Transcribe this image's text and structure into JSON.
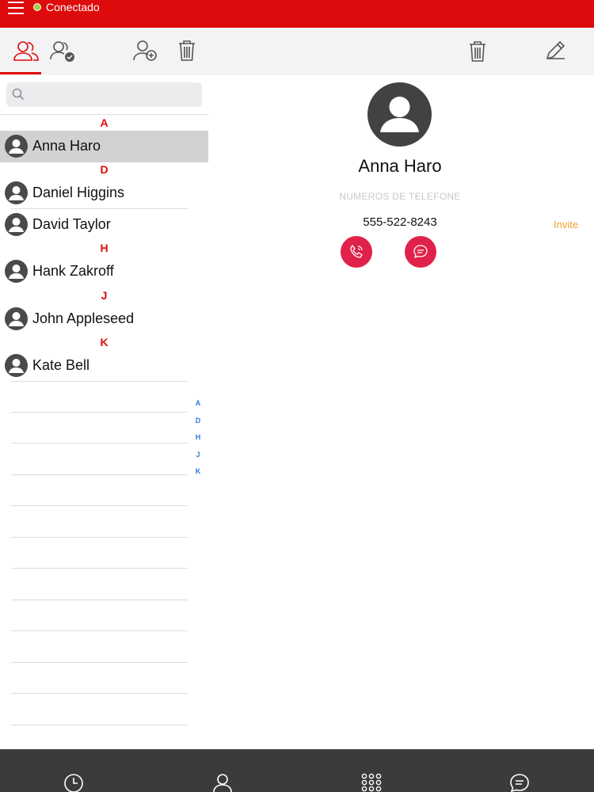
{
  "status": {
    "connection_text": "Conectado",
    "connection_color": "#9ecf3e",
    "bar_color": "#dd0b0b"
  },
  "toolbar_left": {
    "icons": [
      "contacts-icon",
      "shared-contacts-icon",
      "add-contact-icon",
      "trash-icon"
    ]
  },
  "toolbar_right": {
    "icons": [
      "trash-icon",
      "edit-pencil-icon"
    ]
  },
  "search": {
    "placeholder": "",
    "value": ""
  },
  "contacts": {
    "sections": [
      {
        "letter": "A",
        "items": [
          "Anna Haro"
        ]
      },
      {
        "letter": "D",
        "items": [
          "Daniel Higgins",
          "David Taylor"
        ]
      },
      {
        "letter": "H",
        "items": [
          "Hank Zakroff"
        ]
      },
      {
        "letter": "J",
        "items": [
          "John Appleseed"
        ]
      },
      {
        "letter": "K",
        "items": [
          "Kate Bell"
        ]
      }
    ],
    "selected": "Anna Haro",
    "index": [
      "A",
      "D",
      "H",
      "J",
      "K"
    ]
  },
  "detail": {
    "name": "Anna Haro",
    "phone_label": "NUMEROS DE TELEFONE",
    "phone_number": "555-522-8243",
    "invite": "Invite",
    "action_color": "#e0214a"
  },
  "bottom_tabs": [
    "history-clock-icon",
    "contacts-person-icon",
    "dialpad-icon",
    "chat-bubble-icon"
  ]
}
